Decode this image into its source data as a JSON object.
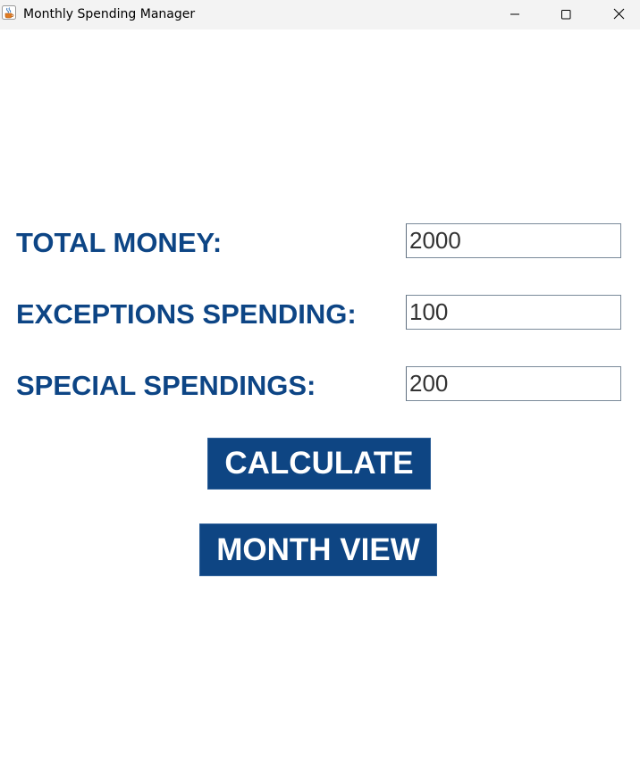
{
  "window": {
    "title": "Monthly Spending Manager",
    "app_icon": "java-cup-icon",
    "controls": [
      "minimize-icon",
      "maximize-icon",
      "close-icon"
    ]
  },
  "form": {
    "total_money": {
      "label": "TOTAL MONEY:",
      "value": "2000"
    },
    "exceptions_spending": {
      "label": "EXCEPTIONS SPENDING:",
      "value": "100"
    },
    "special_spendings": {
      "label": "SPECIAL SPENDINGS:",
      "value": "200"
    }
  },
  "buttons": {
    "calculate": "CALCULATE",
    "month_view": "MONTH VIEW"
  },
  "colors": {
    "label_text": "#0d4585",
    "button_bg": "#0e4583",
    "button_text": "#ffffff",
    "titlebar_bg": "#f3f3f3"
  }
}
